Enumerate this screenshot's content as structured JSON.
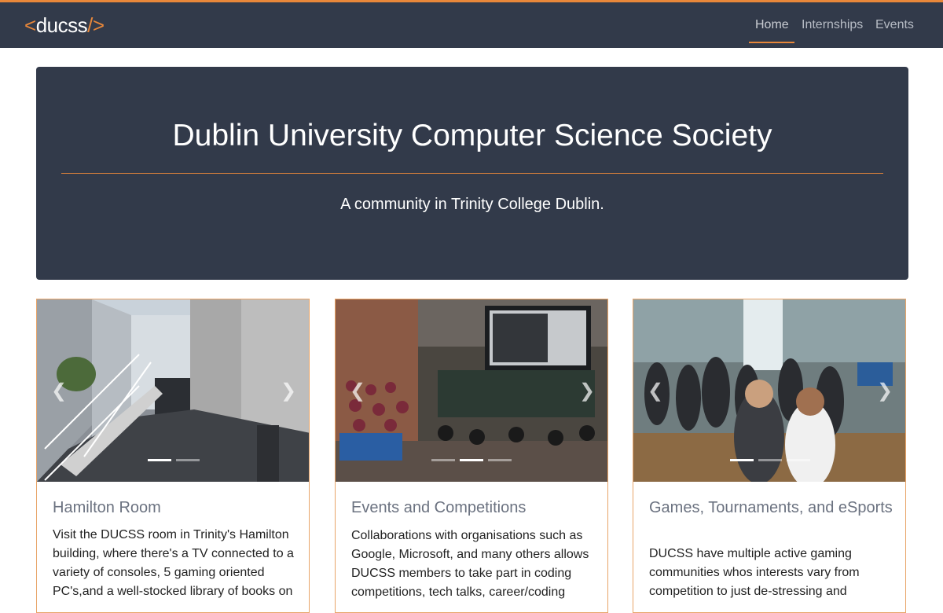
{
  "nav": {
    "logo": {
      "left": "<",
      "text": "ducss",
      "right": "/>"
    },
    "links": [
      "Home",
      "Internships",
      "Events"
    ],
    "accent": "#e8873a",
    "background": "#323a4a"
  },
  "hero": {
    "title": "Dublin University Computer Science Society",
    "subtitle": "A community in Trinity College Dublin."
  },
  "cards": [
    {
      "title": "Hamilton Room",
      "text": "Visit the DUCSS room in Trinity's Hamilton building, where there's a TV connected to a variety of consoles, 5 gaming oriented PC's,and a well-stocked library of books on",
      "image": "modern-building-stairs-photo",
      "slides": 2,
      "active_slide": 1
    },
    {
      "title": "Events and Competitions",
      "text": "Collaborations with organisations such as Google, Microsoft, and many others allows DUCSS members to take part in coding competitions, tech talks, career/coding",
      "image": "lecture-theatre-photo",
      "slides": 3,
      "active_slide": 2
    },
    {
      "title": "Games, Tournaments, and eSports",
      "text": "DUCSS have multiple active gaming communities whos interests vary from competition to just de-stressing and",
      "image": "gaming-event-crowd-photo",
      "slides": 3,
      "active_slide": 1
    }
  ],
  "icons": {
    "prev": "chevron-left-icon",
    "next": "chevron-right-icon"
  }
}
